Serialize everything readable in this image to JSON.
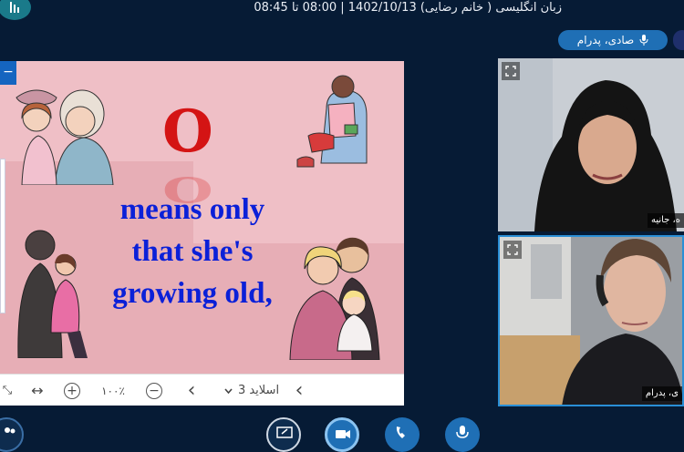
{
  "header": {
    "title": "زبان انگلیسی ( خانم رضایی) 1402/10/13 | 08:00 تا 08:45"
  },
  "participant_pill": {
    "name": "صادی، پدرام"
  },
  "slide": {
    "big_letter": "O",
    "lines": [
      "means only",
      "that she's",
      "growing old,"
    ]
  },
  "toolbar": {
    "fit_icon": "⤡",
    "width_icon": "↔",
    "zoom_in": "+",
    "zoom_level": "۱۰۰٪",
    "zoom_out": "−",
    "prev": "‹",
    "slide_selector": "اسلاید 3",
    "next": "‹"
  },
  "videos": [
    {
      "name": "ه، جانیه"
    },
    {
      "name": "ی، پدرام"
    }
  ],
  "colors": {
    "background": "#061b35",
    "accent": "#1f6fb5",
    "slide_bg": "#e7aeb6",
    "slide_text": "#0b20d8",
    "letter": "#d41414"
  }
}
